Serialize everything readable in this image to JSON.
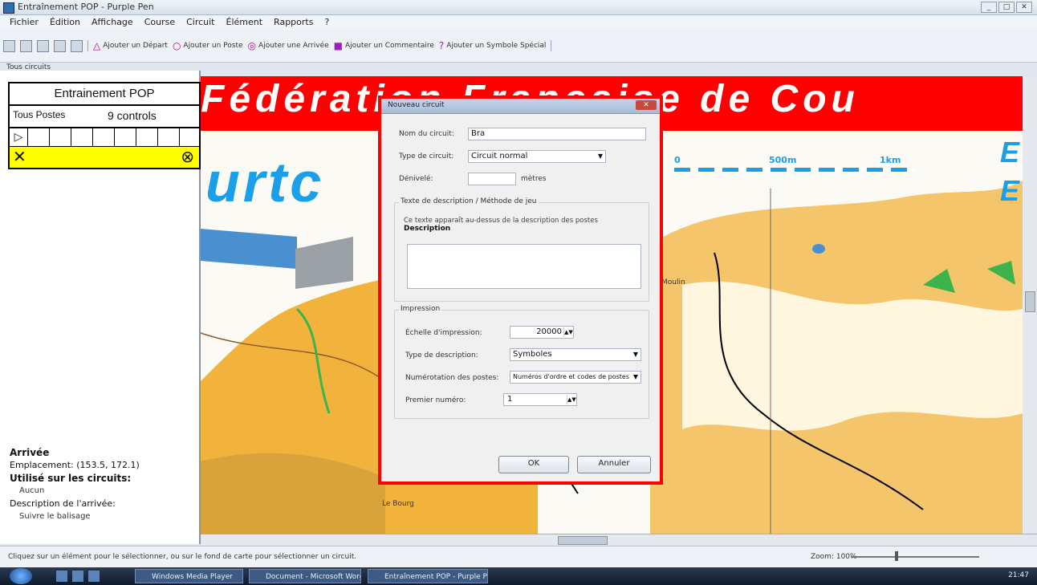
{
  "window": {
    "title": "Entraînement POP - Purple Pen",
    "buttons": [
      "_",
      "□",
      "✕"
    ]
  },
  "menu": [
    "Fichier",
    "Édition",
    "Affichage",
    "Course",
    "Circuit",
    "Élément",
    "Rapports",
    "?"
  ],
  "toolbar": {
    "items": [
      {
        "icon": "triangle-icon",
        "label": "Ajouter un Départ",
        "color": "#c0008c"
      },
      {
        "icon": "circle-icon",
        "label": "Ajouter un Poste",
        "color": "#c0008c"
      },
      {
        "icon": "double-circle-icon",
        "label": "Ajouter une Arrivée",
        "color": "#c0008c"
      },
      {
        "icon": "square-icon",
        "label": "Ajouter un Commentaire",
        "color": "#9b1fbf"
      },
      {
        "icon": "question-icon",
        "label": "Ajouter un Symbole Spécial",
        "color": "#9b1fbf"
      }
    ],
    "course_tab": "Tous circuits"
  },
  "left_panel": {
    "course_title": "Entrainement POP",
    "col_left": "Tous Postes",
    "col_right": "9 controls",
    "start_symbol": "▷",
    "finish_left": "✕",
    "finish_right": "⊗",
    "info": {
      "heading": "Arrivée",
      "coords_label": "Emplacement:",
      "coords_value": "(153.5, 172.1)",
      "used_label": "Utilisé sur les circuits:",
      "used_value": "Aucun",
      "desc_label": "Description de l'arrivée:",
      "desc_value": "Suivre le balisage"
    }
  },
  "map": {
    "banner": "Fédération Française de Cou",
    "big_text": "urtc",
    "right_text_1": "E",
    "right_text_2": "E",
    "scale_labels": [
      "0",
      "500m",
      "1km"
    ],
    "place_1": "Le Bourg",
    "place_2": "Moulin"
  },
  "dialog": {
    "title": "Nouveau circuit",
    "close": "✕",
    "name_label": "Nom du circuit:",
    "name_value": "Bra",
    "type_label": "Type de circuit:",
    "type_value": "Circuit normal",
    "climb_label": "Dénivelé:",
    "climb_unit": "mètres",
    "desc_group_label": "Texte de description / Méthode de jeu",
    "desc_text": "Ce texte apparaît au-dessus de la description des postes",
    "desc_bold": "Description",
    "print_group_label": "Impression",
    "scale_label": "Échelle d'impression:",
    "scale_value": "20000",
    "desc_kind_label": "Type de description:",
    "desc_kind_value": "Symboles",
    "numbering_label": "Numérotation des postes:",
    "numbering_value": "Numéros d'ordre et codes de postes",
    "first_label": "Premier numéro:",
    "first_value": "1",
    "ok_label": "OK",
    "cancel_label": "Annuler"
  },
  "status": {
    "message": "Cliquez sur un élément pour le sélectionner, ou sur le fond de carte pour sélectionner un circuit.",
    "zoom_label": "Zoom: 100%"
  },
  "taskbar": {
    "tasks": [
      "Windows Media Player",
      "Document - Microsoft Word",
      "Entraînement POP - Purple Pen"
    ],
    "clock": "21:47"
  }
}
